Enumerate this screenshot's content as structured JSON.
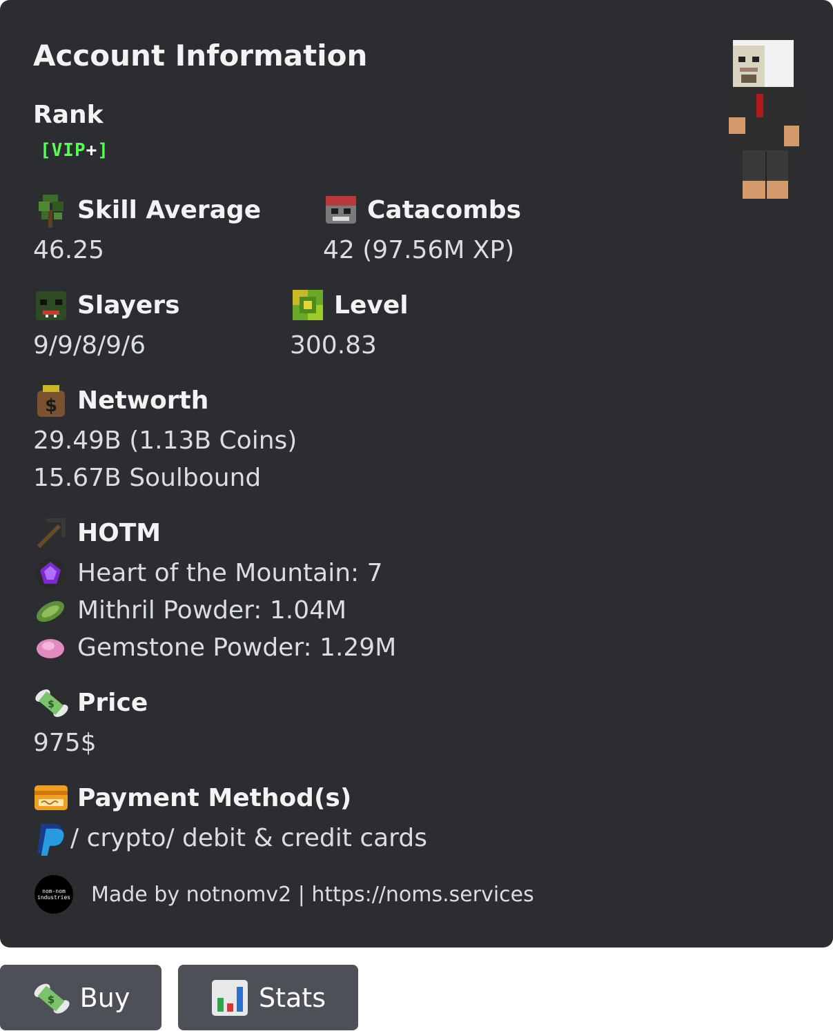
{
  "embed": {
    "title": "Account Information",
    "rank": {
      "label": "Rank",
      "bracket_open": "[",
      "tier": "VIP",
      "plus": "+",
      "bracket_close": "]"
    },
    "skill_average": {
      "label": "Skill Average",
      "value": "46.25",
      "icon": "sapling-icon"
    },
    "catacombs": {
      "label": "Catacombs",
      "value": "42 (97.56M XP)",
      "icon": "wither-skull-icon"
    },
    "slayers": {
      "label": "Slayers",
      "value": "9/9/8/9/6",
      "icon": "zombie-head-icon"
    },
    "level": {
      "label": "Level",
      "value": "300.83",
      "icon": "xp-block-icon"
    },
    "networth": {
      "label": "Networth",
      "value_line1": "29.49B (1.13B Coins)",
      "value_line2": "15.67B Soulbound",
      "icon": "money-bag-icon"
    },
    "hotm": {
      "label": "HOTM",
      "icon": "pickaxe-icon",
      "heart": "Heart of the Mountain: 7",
      "mithril": "Mithril Powder: 1.04M",
      "gemstone": "Gemstone Powder: 1.29M"
    },
    "price": {
      "label": "Price",
      "value": "975$",
      "icon": "money-wings-icon"
    },
    "payment": {
      "label": "Payment Method(s)",
      "value": "/ crypto/ debit & credit cards",
      "icon": "credit-card-icon"
    },
    "footer": {
      "text": "Made by notnomv2 | https://noms.services",
      "logo_line1": "nom-nom",
      "logo_line2": "industries"
    }
  },
  "buttons": {
    "buy": "Buy",
    "stats": "Stats"
  },
  "colors": {
    "embed_bg": "#2b2d31",
    "button_bg": "#4e5058",
    "rank_green": "#55ff55"
  }
}
